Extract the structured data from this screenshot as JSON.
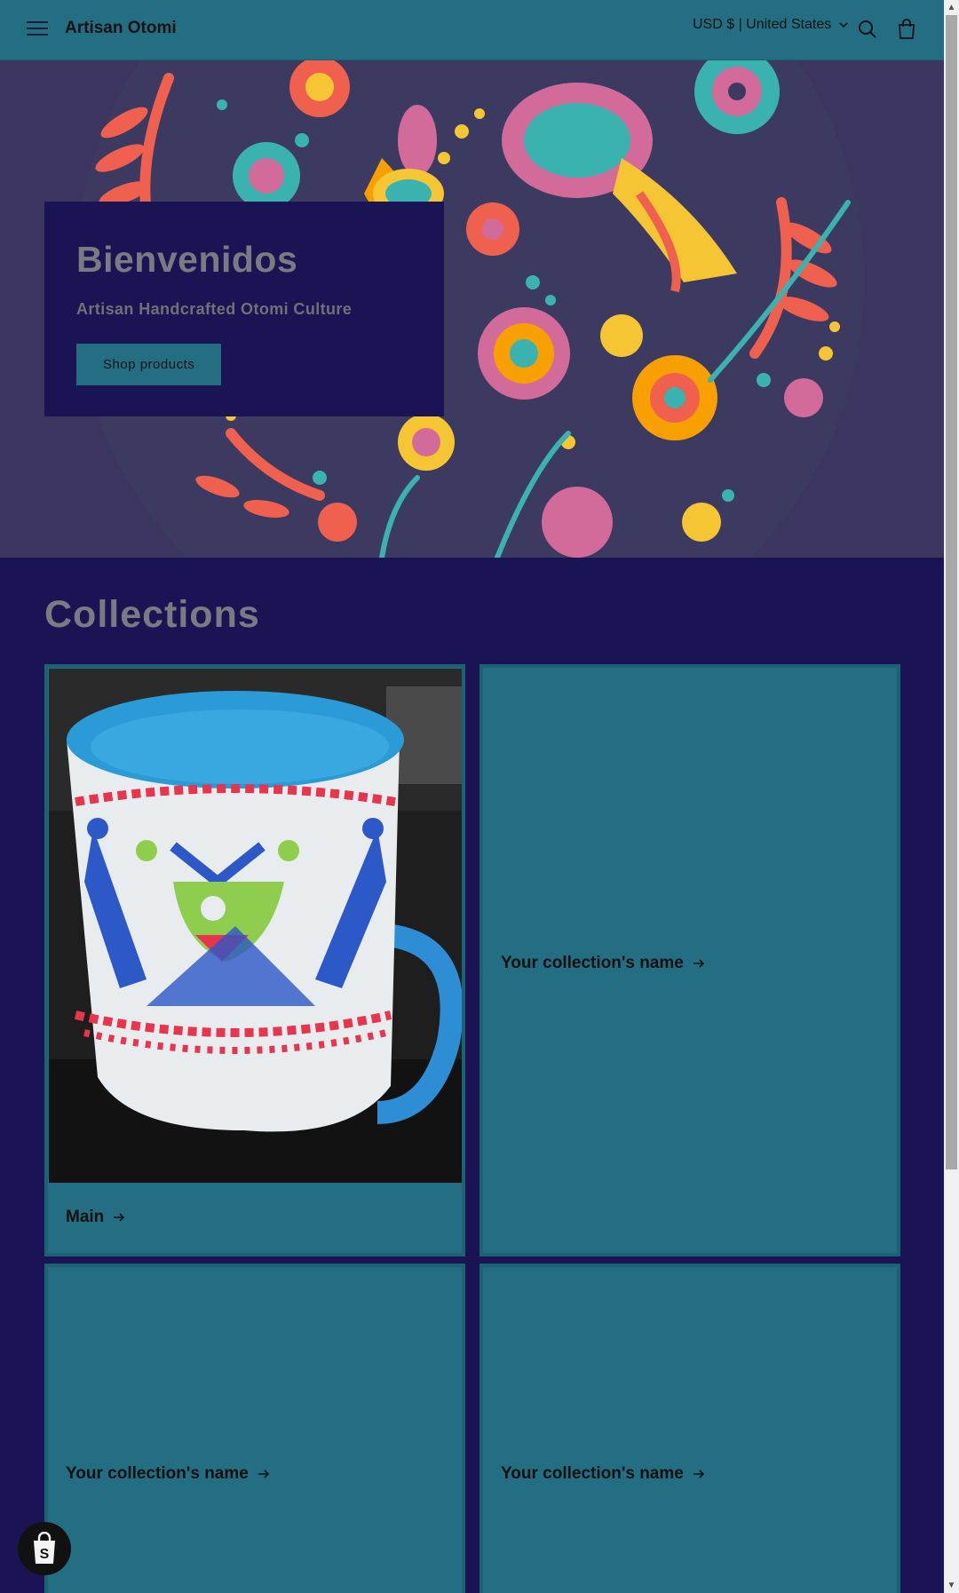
{
  "header": {
    "brand": "Artisan Otomi",
    "locale": "USD $ | United States"
  },
  "hero": {
    "title": "Bienvenidos",
    "subtitle": "Artisan Handcrafted Otomi Culture",
    "button": "Shop products"
  },
  "collections": {
    "title": "Collections",
    "cards": [
      {
        "label": "Main"
      },
      {
        "label": "Your collection's name"
      },
      {
        "label": "Your collection's name"
      },
      {
        "label": "Your collection's name"
      }
    ]
  },
  "icons": [
    "hamburger-icon",
    "search-icon",
    "cart-icon",
    "chevron-down-icon",
    "arrow-right-icon",
    "shopify-bag-icon"
  ],
  "colors": {
    "header": "#236e82",
    "page": "#1a1454",
    "hero_bg": "#3b3560",
    "card": "#236e82"
  }
}
